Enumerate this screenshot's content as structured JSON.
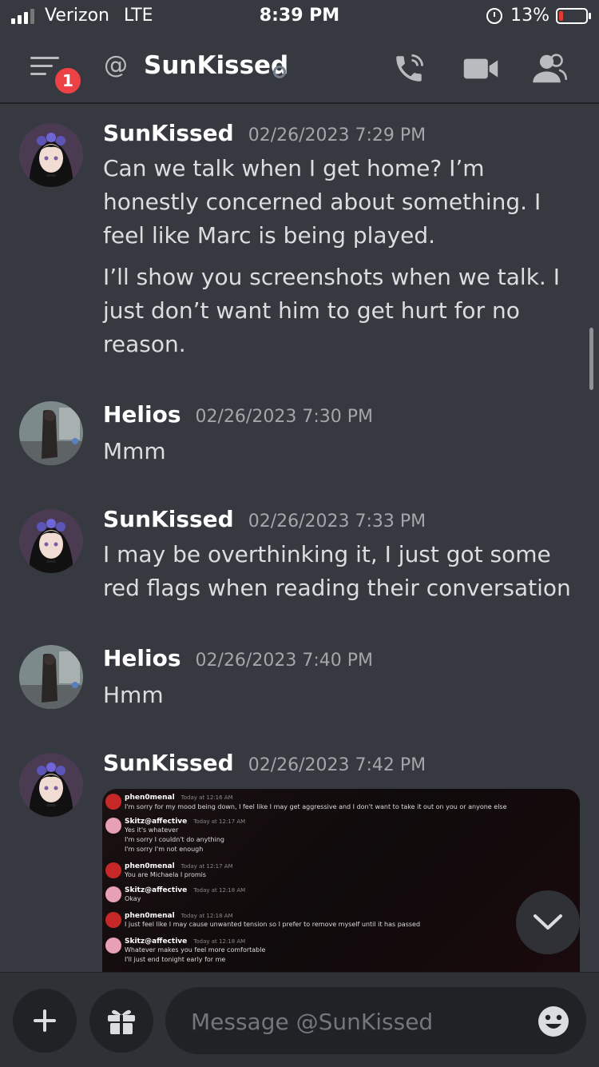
{
  "status_bar": {
    "carrier": "Verizon",
    "network": "LTE",
    "time": "8:39 PM",
    "battery": "13%"
  },
  "header": {
    "badge_count": "1",
    "title": "SunKissed"
  },
  "messages": [
    {
      "author": "SunKissed",
      "timestamp": "02/26/2023 7:29 PM",
      "paragraphs": [
        "Can we talk when I get home? I’m honestly concerned about something. I feel like Marc is being played.",
        "I’ll show you screenshots when we talk. I just don’t want him to get hurt for no reason."
      ]
    },
    {
      "author": "Helios",
      "timestamp": "02/26/2023 7:30 PM",
      "paragraphs": [
        "Mmm"
      ]
    },
    {
      "author": "SunKissed",
      "timestamp": "02/26/2023 7:33 PM",
      "paragraphs": [
        "I may be overthinking it, I just got some red flags when reading their conversation"
      ]
    },
    {
      "author": "Helios",
      "timestamp": "02/26/2023 7:40 PM",
      "paragraphs": [
        "Hmm"
      ]
    },
    {
      "author": "SunKissed",
      "timestamp": "02/26/2023 7:42 PM",
      "paragraphs": []
    }
  ],
  "attachment": {
    "rows": [
      {
        "name": "phen0menal",
        "ts": "Today at 12:16 AM",
        "lines": [
          "I'm sorry for my mood being down, I feel like I may get aggressive and I don't want to take it out on you or anyone else"
        ]
      },
      {
        "name": "Skitz@affective",
        "ts": "Today at 12:17 AM",
        "lines": [
          "Yes it's whatever",
          "I'm sorry I couldn't do anything",
          "I'm sorry I'm not enough"
        ]
      },
      {
        "name": "phen0menal",
        "ts": "Today at 12:17 AM",
        "lines": [
          "You are Michaela I promis"
        ]
      },
      {
        "name": "Skitz@affective",
        "ts": "Today at 12:18 AM",
        "lines": [
          "Okay"
        ]
      },
      {
        "name": "phen0menal",
        "ts": "Today at 12:18 AM",
        "lines": [
          "I just feel like I may cause unwanted tension so I prefer to remove myself until it has passed"
        ]
      },
      {
        "name": "Skitz@affective",
        "ts": "Today at 12:18 AM",
        "lines": [
          "Whatever makes you feel more comfortable",
          "I'll just end tonight early for me"
        ]
      }
    ]
  },
  "composer": {
    "placeholder": "Message @SunKissed"
  },
  "icons": [
    "signal-icon",
    "alarm-icon",
    "battery-icon",
    "menu-icon",
    "at-icon",
    "phone-icon",
    "video-icon",
    "members-icon",
    "chevron-down-icon",
    "plus-icon",
    "gift-icon",
    "emoji-icon"
  ],
  "colors": {
    "background": "#36393f",
    "composer": "#2f3136",
    "input": "#202225",
    "badge": "#ed4245"
  }
}
